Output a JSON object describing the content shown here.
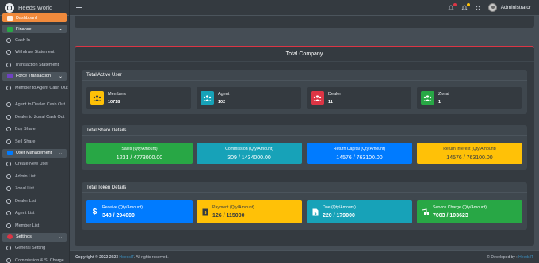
{
  "brand": {
    "name": "Heeds World"
  },
  "sidebar": {
    "dashboard": "Dashboard",
    "finance": {
      "label": "Finance",
      "items": [
        "Cash In",
        "Withdraw Statement",
        "Transaction Statement"
      ]
    },
    "force_transaction": {
      "label": "Force Transaction",
      "items": [
        "Member to Agent Cash Out",
        "Agent to Dealer Cash Out",
        "Dealer to Zonal Cash Out",
        "Buy Share",
        "Sell Share"
      ]
    },
    "user_management": {
      "label": "User Management",
      "items": [
        "Create New User",
        "Admin List",
        "Zonal List",
        "Dealer List",
        "Agent List",
        "Member List"
      ]
    },
    "settings": {
      "label": "Settings",
      "items": [
        "General Setting",
        "Commission & S. Charge"
      ]
    }
  },
  "topbar": {
    "user": "Administrator",
    "icons": [
      "bell-icon",
      "notification-icon",
      "fullscreen-icon"
    ]
  },
  "company": {
    "title": "Total Company"
  },
  "active_users": {
    "title": "Total Active User",
    "boxes": [
      {
        "label": "Members",
        "value": "10718",
        "color": "#ffc107"
      },
      {
        "label": "Agent",
        "value": "102",
        "color": "#17a2b8"
      },
      {
        "label": "Dealer",
        "value": "11",
        "color": "#dc3545"
      },
      {
        "label": "Zonal",
        "value": "1",
        "color": "#28a745"
      }
    ]
  },
  "share_details": {
    "title": "Total Share Details",
    "boxes": [
      {
        "label": "Sales (Qty/Amount)",
        "value": "1231 / 4773000.00",
        "color": "#28a745"
      },
      {
        "label": "Commission (Qty/Amount)",
        "value": "309 / 1434000.00",
        "color": "#17a2b8"
      },
      {
        "label": "Return Capital (Qty/Amount)",
        "value": "14576 / 763100.00",
        "color": "#007bff"
      },
      {
        "label": "Return Interest (Qty/Amount)",
        "value": "14576 / 763100.00",
        "color": "#ffc107"
      }
    ]
  },
  "token_details": {
    "title": "Total Token Details",
    "boxes": [
      {
        "label": "Receive (Qty/Amount)",
        "value": "348 / 294000",
        "color": "#007bff",
        "icon": "dollar-hand-icon"
      },
      {
        "label": "Payment (Qty/Amount)",
        "value": "126 / 115000",
        "color": "#ffc107",
        "icon": "receipt-icon"
      },
      {
        "label": "Due (Qty/Amount)",
        "value": "220 / 179000",
        "color": "#17a2b8",
        "icon": "invoice-dollar-icon"
      },
      {
        "label": "Service Charge (Qty/Amount)",
        "value": "7003 / 103623",
        "color": "#28a745",
        "icon": "money-check-icon"
      }
    ]
  },
  "footer": {
    "copyright_prefix": "Copyright © 2022-2023",
    "company": "HeedsIT",
    "rights": ". All rights reserved.",
    "developed_prefix": "© Developed by :",
    "developer": "HeedsIT"
  }
}
